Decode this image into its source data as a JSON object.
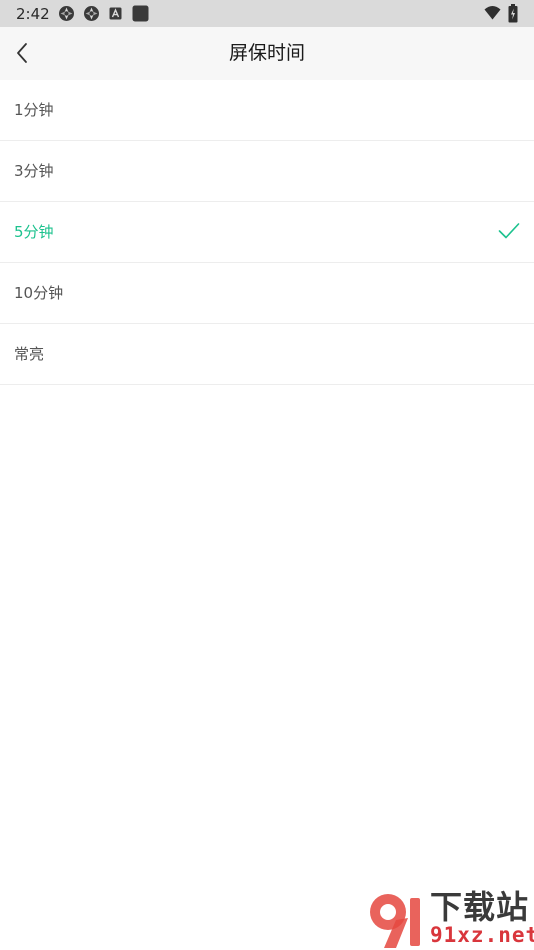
{
  "status_bar": {
    "time": "2:42"
  },
  "header": {
    "title": "屏保时间"
  },
  "options": [
    {
      "label": "1分钟",
      "selected": false
    },
    {
      "label": "3分钟",
      "selected": false
    },
    {
      "label": "5分钟",
      "selected": true
    },
    {
      "label": "10分钟",
      "selected": false
    },
    {
      "label": "常亮",
      "selected": false
    }
  ],
  "watermark": {
    "line1": "下载站",
    "line2": "91xz.net"
  },
  "colors": {
    "accent": "#1cc28e",
    "status_bar_bg": "#dadada",
    "app_bar_bg": "#f7f7f7",
    "divider": "#ededed",
    "text_default": "#555555"
  },
  "icons": {
    "back": "chevron-left-icon",
    "selected_mark": "check-icon"
  }
}
